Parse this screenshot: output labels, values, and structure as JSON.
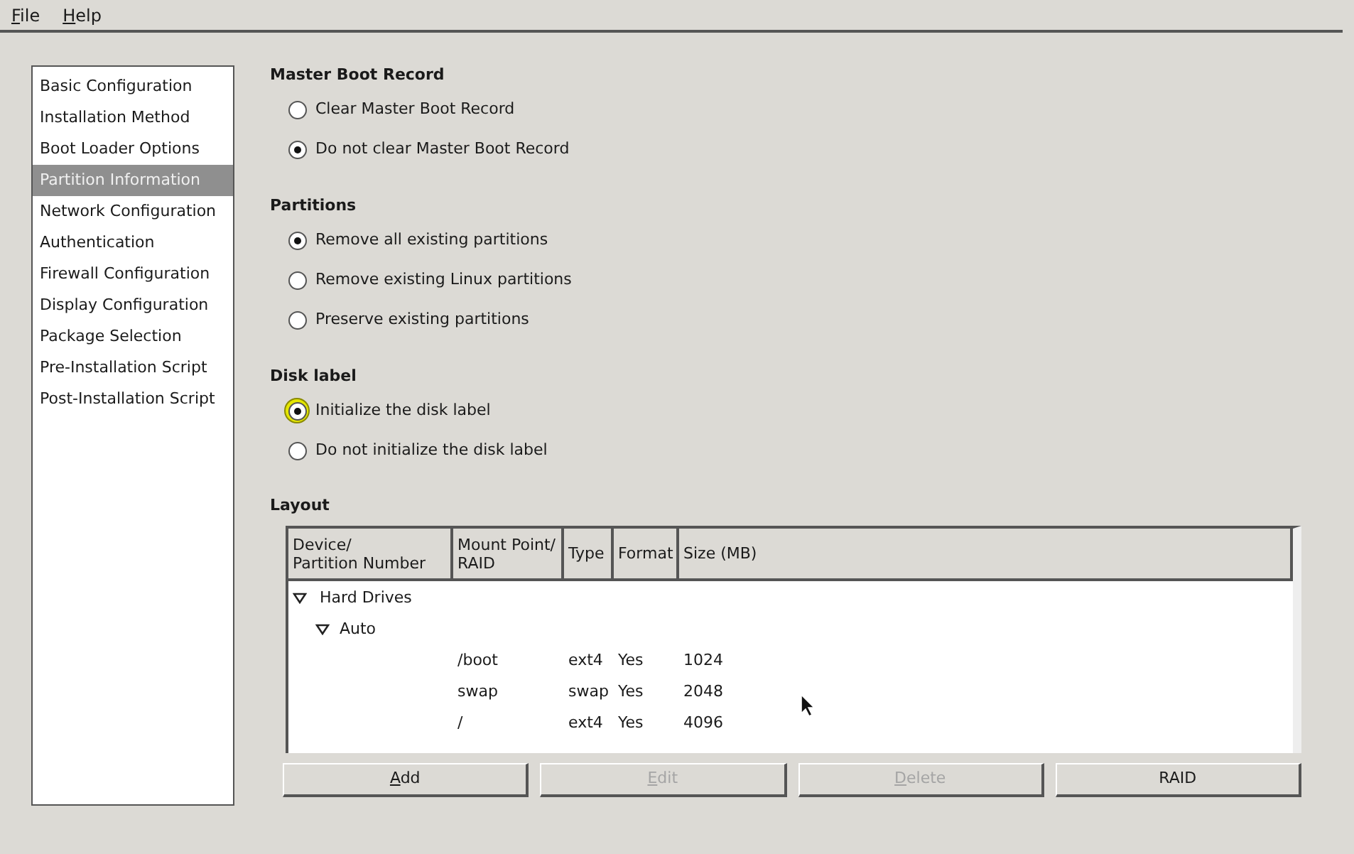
{
  "menu": [
    {
      "label": "File",
      "mnemonic": true
    },
    {
      "label": "Help",
      "mnemonic": true
    }
  ],
  "sidebar": {
    "items": [
      {
        "label": "Basic Configuration",
        "selected": false
      },
      {
        "label": "Installation Method",
        "selected": false
      },
      {
        "label": "Boot Loader Options",
        "selected": false
      },
      {
        "label": "Partition Information",
        "selected": true
      },
      {
        "label": "Network Configuration",
        "selected": false
      },
      {
        "label": "Authentication",
        "selected": false
      },
      {
        "label": "Firewall Configuration",
        "selected": false
      },
      {
        "label": "Display Configuration",
        "selected": false
      },
      {
        "label": "Package Selection",
        "selected": false
      },
      {
        "label": "Pre-Installation Script",
        "selected": false
      },
      {
        "label": "Post-Installation Script",
        "selected": false
      }
    ]
  },
  "sections": [
    {
      "title": "Master Boot Record",
      "options": [
        {
          "label": "Clear Master Boot Record",
          "selected": false,
          "focused": false
        },
        {
          "label": "Do not clear Master Boot Record",
          "selected": true,
          "focused": false
        }
      ]
    },
    {
      "title": "Partitions",
      "options": [
        {
          "label": "Remove all existing partitions",
          "selected": true,
          "focused": false
        },
        {
          "label": "Remove existing Linux partitions",
          "selected": false,
          "focused": false
        },
        {
          "label": "Preserve existing partitions",
          "selected": false,
          "focused": false
        }
      ]
    },
    {
      "title": "Disk label",
      "options": [
        {
          "label": "Initialize the disk label",
          "selected": true,
          "focused": true
        },
        {
          "label": "Do not initialize the disk label",
          "selected": false,
          "focused": false
        }
      ]
    }
  ],
  "layout": {
    "title": "Layout",
    "columns": [
      "Device/\nPartition Number",
      "Mount Point/\nRAID",
      "Type",
      "Format",
      "Size (MB)"
    ],
    "tree": [
      {
        "device": "Hard Drives",
        "expanded": true,
        "children": [
          {
            "device": "Auto",
            "expanded": true,
            "children": [
              {
                "mount": "/boot",
                "type": "ext4",
                "format": "Yes",
                "size": "1024"
              },
              {
                "mount": "swap",
                "type": "swap",
                "format": "Yes",
                "size": "2048"
              },
              {
                "mount": "/",
                "type": "ext4",
                "format": "Yes",
                "size": "4096"
              }
            ]
          }
        ]
      }
    ]
  },
  "buttons": [
    {
      "label": "Add",
      "mnemonic": true,
      "disabled": false
    },
    {
      "label": "Edit",
      "mnemonic": true,
      "disabled": true
    },
    {
      "label": "Delete",
      "mnemonic": true,
      "disabled": true
    },
    {
      "label": "RAID",
      "mnemonic": false,
      "disabled": false
    }
  ]
}
